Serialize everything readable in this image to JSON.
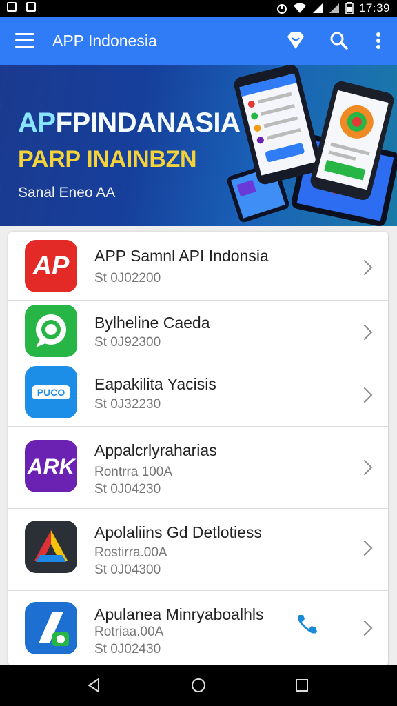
{
  "status_bar": {
    "time": "17:39",
    "icons": [
      "notification-icon",
      "notification-icon",
      "alarm-icon",
      "wifi-icon",
      "signal-icon",
      "signal-icon",
      "battery-icon"
    ]
  },
  "app_bar": {
    "title": "APP Indonesia",
    "actions": [
      "shop-icon",
      "search-icon",
      "more-vert-icon"
    ]
  },
  "banner": {
    "headline_a": "AP",
    "headline_b": "FPINDANASIA",
    "subheadline": "PARP INAINBZN",
    "tagline": "Sanal Eneo AA"
  },
  "apps": [
    {
      "name": "APP Samnl API Indonsia",
      "line1": "St  0J02200",
      "line2": "",
      "icon_name": "app-logo-ap-icon",
      "icon_text": "AP",
      "icon_color": "#e42a27"
    },
    {
      "name": "Bylheline Caeda",
      "line1": "St  0J92300",
      "line2": "",
      "icon_name": "chat-bubble-icon",
      "icon_text": "",
      "icon_color": "#27b546"
    },
    {
      "name": "Eapakilita Yacisis",
      "line1": "St  0J32230",
      "line2": "",
      "icon_name": "puco-logo-icon",
      "icon_text": "PUCO",
      "icon_color": "#1c8ee8"
    },
    {
      "name": "Appalcrlyraharias",
      "line1": "Rontrra 100A",
      "line2": "St  0J04230",
      "icon_name": "ark-logo-icon",
      "icon_text": "ARK",
      "icon_color": "#6b22b3"
    },
    {
      "name": "Apolaliins Gd Detlotiess",
      "line1": "Rostirra.00A",
      "line2": "St  0J04300",
      "icon_name": "colorful-a-logo-icon",
      "icon_text": "",
      "icon_color": "#2b2f36"
    },
    {
      "name": "Apulanea Minryaboalhls",
      "line1": "Rotriaa.00A",
      "line2": "St  0J02430",
      "icon_name": "a-chat-logo-icon",
      "icon_text": "",
      "icon_color": "#1d6fd1",
      "extra_icon": "phone-icon"
    }
  ],
  "nav_bar": {
    "buttons": [
      "back-icon",
      "home-icon",
      "recents-icon"
    ]
  },
  "colors": {
    "app_bar": "#2f7cf6",
    "banner_headline": "#f4fbff",
    "banner_sub": "#f3d23a",
    "phone_accent": "#1a8bd8"
  }
}
